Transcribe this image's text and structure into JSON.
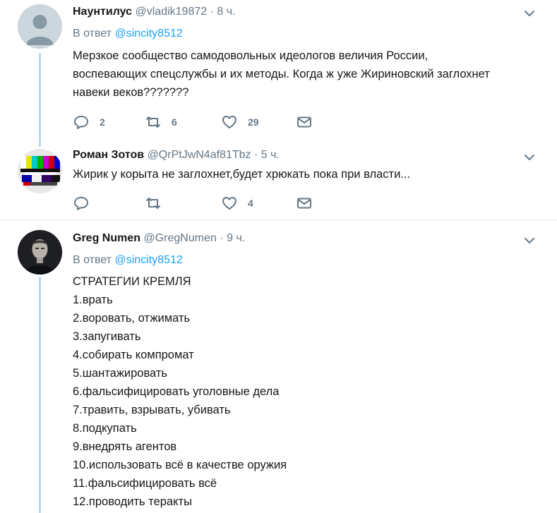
{
  "tweets": [
    {
      "name": "Наунтилус",
      "handle": "@vladik19872",
      "dot": "·",
      "time": "8 ч.",
      "reply_prefix": "В ответ",
      "reply_mention": "@sincity8512",
      "lines": [
        "Мерзкое сообщество самодовольных идеологов величия России,",
        "воспевающих спецслужбы и их методы. Когда ж уже Жириновский заглохнет",
        "навеки веков???????"
      ],
      "replies": "2",
      "retweets": "6",
      "likes": "29"
    },
    {
      "name": "Роман Зотов",
      "handle": "@QrPtJwN4af81Tbz",
      "dot": "·",
      "time": "5 ч.",
      "lines": [
        "Жирик у корыта не заглохнет,будет хрюкать пока при власти..."
      ],
      "replies": "",
      "retweets": "",
      "likes": "4"
    },
    {
      "name": "Greg Numen",
      "handle": "@GregNumen",
      "dot": "·",
      "time": "9 ч.",
      "reply_prefix": "В ответ",
      "reply_mention": "@sincity8512",
      "lines": [
        "СТРАТЕГИИ КРЕМЛЯ",
        "1.врать",
        "2.воровать, отжимать",
        "3.запугивать",
        "4.собирать компромат",
        "5.шантажировать",
        "6.фальсифицировать уголовные дела",
        "7.травить, взрывать, убивать",
        "8.подкупать",
        "9.внедрять агентов",
        "10.использовать всё в качестве оружия",
        "11.фальсифицировать всё",
        "12.проводить теракты"
      ]
    }
  ],
  "icons": {
    "reply": "reply-icon",
    "retweet": "retweet-icon",
    "like": "heart-icon",
    "dm": "envelope-icon",
    "caret": "chevron-down-icon"
  },
  "colors": {
    "link": "#1da1f2",
    "muted": "#657786",
    "thread_line": "#b4d9ef",
    "text": "#14171a"
  }
}
